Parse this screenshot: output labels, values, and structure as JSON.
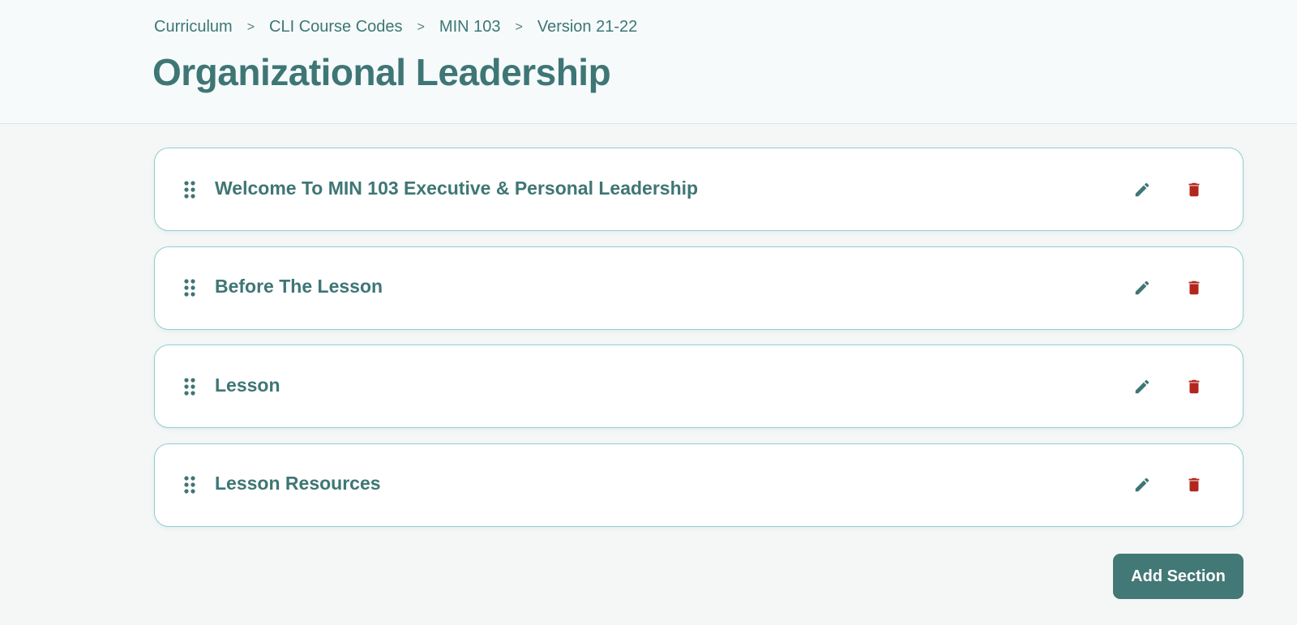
{
  "breadcrumb": {
    "items": [
      "Curriculum",
      "CLI Course Codes",
      "MIN 103",
      "Version 21-22"
    ],
    "separator": ">"
  },
  "page": {
    "title": "Organizational Leadership"
  },
  "sections": [
    {
      "title": "Welcome To MIN 103 Executive & Personal Leadership",
      "icons": [
        "drag-handle-icon",
        "pencil-icon",
        "trash-icon"
      ]
    },
    {
      "title": "Before The Lesson",
      "icons": [
        "drag-handle-icon",
        "pencil-icon",
        "trash-icon"
      ]
    },
    {
      "title": "Lesson",
      "icons": [
        "drag-handle-icon",
        "pencil-icon",
        "trash-icon"
      ]
    },
    {
      "title": "Lesson Resources",
      "icons": [
        "drag-handle-icon",
        "pencil-icon",
        "trash-icon"
      ]
    }
  ],
  "actions": {
    "add_section_label": "Add Section"
  },
  "colors": {
    "accent": "#3e7675",
    "card_border": "#8fcfcd",
    "delete": "#b3261e",
    "button_bg": "#427876"
  }
}
